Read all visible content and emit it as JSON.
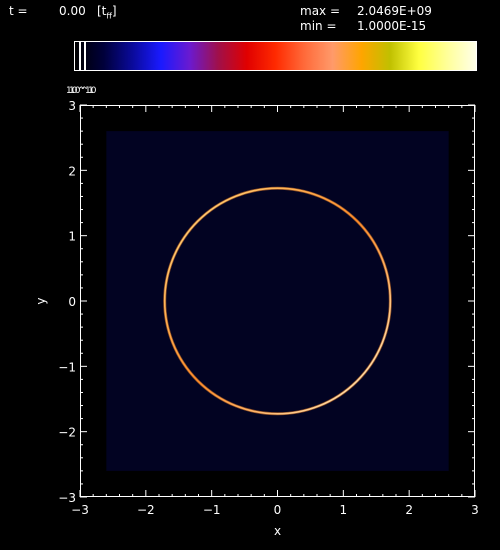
{
  "header": {
    "time_label": "t =",
    "time_value": "0.00",
    "time_unit_open": "[t",
    "time_unit_sub": "ff",
    "time_unit_close": "]",
    "max_label": "max =",
    "max_value": "2.0469E+09",
    "min_label": "min =",
    "min_value": "1.0000E-15"
  },
  "colorbar": {
    "scale_label": "10^10",
    "scale_label_overlap": "10^1",
    "stops": [
      "#000000",
      "#00003a",
      "#0a0a9a",
      "#1a1aff",
      "#6a1ad0",
      "#a0104a",
      "#e00000",
      "#ff2a00",
      "#ff6a3a",
      "#ff9a6a",
      "#ffa500",
      "#c0c000",
      "#ffff40",
      "#ffff9a",
      "#ffffe8"
    ],
    "markers": [
      "#ffffff"
    ]
  },
  "chart_data": {
    "type": "heatmap",
    "xlabel": "x",
    "ylabel": "y",
    "xlim": [
      -3,
      3
    ],
    "ylim": [
      -3,
      3
    ],
    "x_ticks": [
      -3,
      -2,
      -1,
      0,
      1,
      2,
      3
    ],
    "y_ticks": [
      -3,
      -2,
      -1,
      0,
      1,
      2,
      3
    ],
    "x_tick_labels": [
      "−3",
      "−2",
      "−1",
      "0",
      "1",
      "2",
      "3"
    ],
    "y_tick_labels": [
      "−3",
      "−2",
      "−1",
      "0",
      "1",
      "2",
      "3"
    ],
    "domain_extent": [
      -2.6,
      2.6
    ],
    "ring_center": [
      0,
      0
    ],
    "ring_radius": 1.72,
    "background_color": "#000000",
    "domain_color": "#020322",
    "ring_colors": [
      "#ffe08a",
      "#ff8c28",
      "#fff6d0"
    ]
  }
}
